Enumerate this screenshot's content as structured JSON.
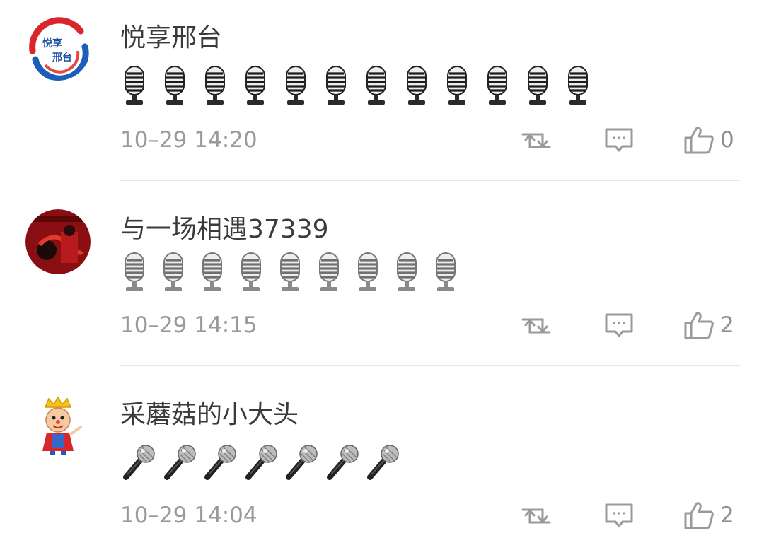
{
  "comments": [
    {
      "username": "悦享邢台",
      "avatar_text_top": "悦享",
      "avatar_text_bottom": "邢台",
      "emoji": "studio-microphone-emoji",
      "emoji_count": 12,
      "time": "10–29 14:20",
      "likes": "0"
    },
    {
      "username": "与一场相遇37339",
      "emoji": "studio-microphone-emoji",
      "emoji_count": 9,
      "time": "10–29 14:15",
      "likes": "2"
    },
    {
      "username": "采蘑菇的小大头",
      "emoji": "microphone-emoji",
      "emoji_count": 7,
      "time": "10–29 14:04",
      "likes": "2"
    }
  ],
  "icons": {
    "repost": "repost-icon",
    "reply": "comment-icon",
    "like": "thumbs-up-icon"
  },
  "colors": {
    "username": "#3a3a3a",
    "meta": "#9a9a9a",
    "divider": "#e6e6e6"
  }
}
